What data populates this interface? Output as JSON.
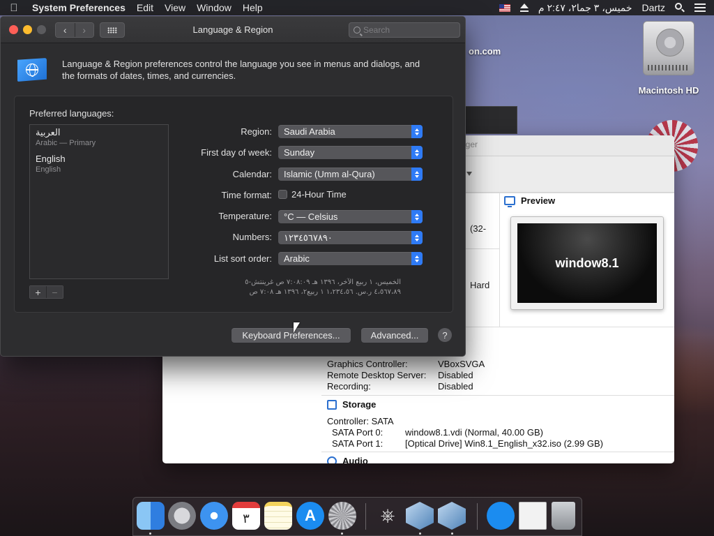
{
  "menubar": {
    "app_name": "System Preferences",
    "items": [
      "Edit",
      "View",
      "Window",
      "Help"
    ],
    "clock": "خميس، ٣ جما٢، ٢:٤٧ م",
    "user": "Dartz"
  },
  "desktop": {
    "hd_label": "Macintosh HD"
  },
  "prefs": {
    "title": "Language & Region",
    "search_placeholder": "Search",
    "intro": "Language & Region preferences control the language you see in menus and dialogs, and the formats of dates, times, and currencies.",
    "preferred_languages_label": "Preferred languages:",
    "languages": [
      {
        "name": "العربية",
        "sub": "Arabic — Primary"
      },
      {
        "name": "English",
        "sub": "English"
      }
    ],
    "add_symbol": "+",
    "remove_symbol": "−",
    "fields": {
      "region": {
        "label": "Region:",
        "value": "Saudi Arabia"
      },
      "first_day": {
        "label": "First day of week:",
        "value": "Sunday"
      },
      "calendar": {
        "label": "Calendar:",
        "value": "Islamic (Umm al-Qura)"
      },
      "time_format": {
        "label": "Time format:",
        "checkbox_label": "24-Hour Time",
        "checked": false
      },
      "temperature": {
        "label": "Temperature:",
        "value": "°C — Celsius"
      },
      "numbers": {
        "label": "Numbers:",
        "value": "١٢٣٤٥٦٧٨٩٠"
      },
      "sort_order": {
        "label": "List sort order:",
        "value": "Arabic"
      }
    },
    "sample_line1": "الخميس، ١ ربيع الآخر، ١٣٩٦ هـ ٧:٠٨:٠٩ ص غرينتش-٥",
    "sample_line2": "٤،٥٦٧،٨٩ ر.س.    ١،٢٣٤،٥٦     ١ ربيع٢، ١٣٩٦ هـ ٧:٠٨ ص",
    "keyboard_button": "Keyboard Preferences...",
    "advanced_button": "Advanced...",
    "help_symbol": "?"
  },
  "vbox": {
    "title_fragment": "ager",
    "site_fragment": "on.com",
    "left_fragments": [
      "(32-",
      "Hard"
    ],
    "preview_label": "Preview",
    "preview_vm_name": "window8.1",
    "display_rows": [
      {
        "key": "Graphics Controller:",
        "value": "VBoxSVGA"
      },
      {
        "key": "Remote Desktop Server:",
        "value": "Disabled"
      },
      {
        "key": "Recording:",
        "value": "Disabled"
      }
    ],
    "storage_label": "Storage",
    "controller": "Controller: SATA",
    "storage_rows": [
      {
        "key": "SATA Port 0:",
        "value": "window8.1.vdi (Normal, 40.00 GB)"
      },
      {
        "key": "SATA Port 1:",
        "value": "[Optical Drive] Win8.1_English_x32.iso (2.99 GB)"
      }
    ],
    "audio_label": "Audio"
  },
  "dock": {
    "calendar_day": "٣",
    "appstore_glyph": "A"
  }
}
